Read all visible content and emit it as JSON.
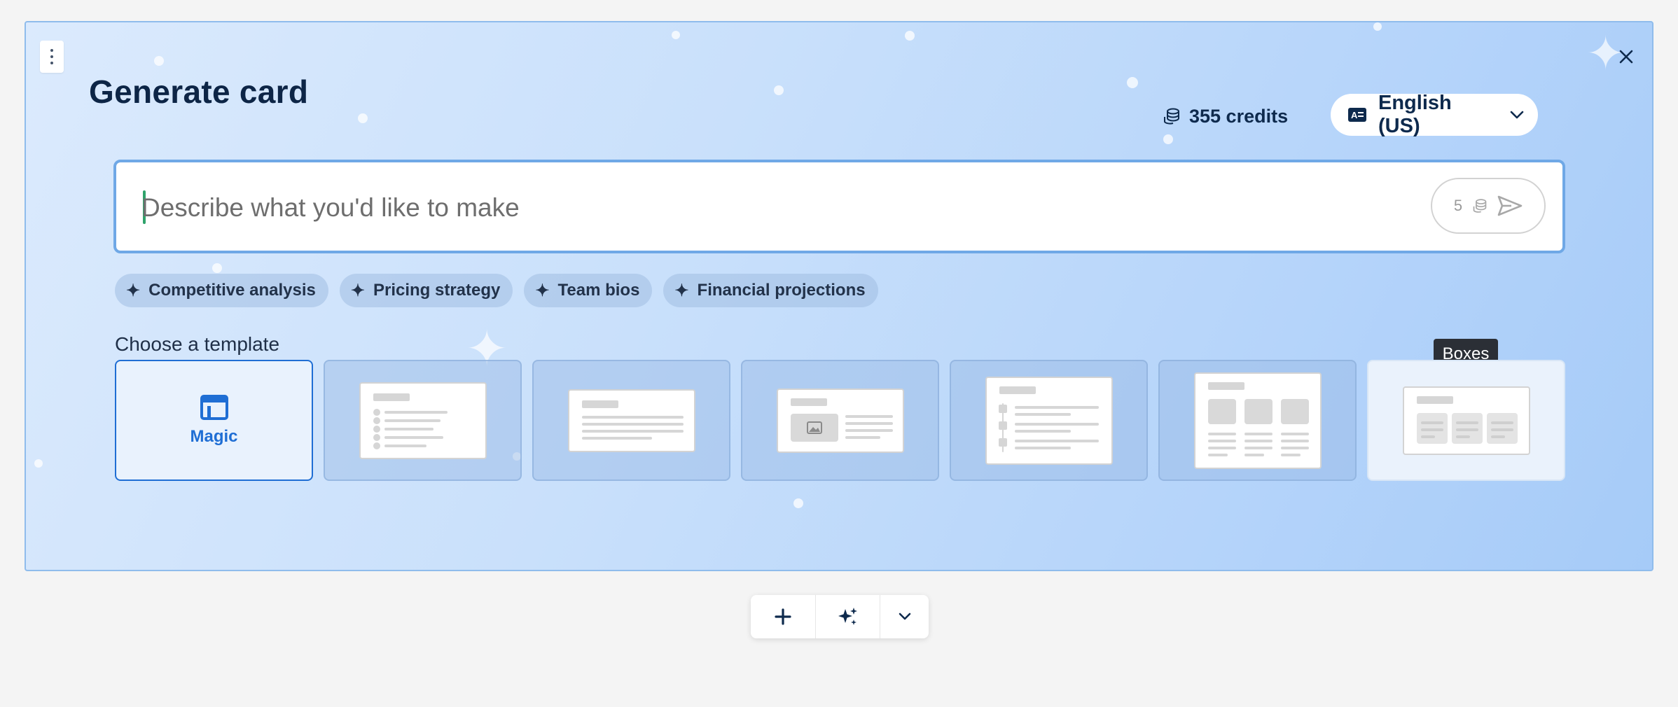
{
  "dialog": {
    "title": "Generate card",
    "credits": "355 credits",
    "language": "English (US)"
  },
  "prompt": {
    "placeholder": "Describe what you'd like to make",
    "cost": "5"
  },
  "suggestions": [
    "Competitive analysis",
    "Pricing strategy",
    "Team bios",
    "Financial projections"
  ],
  "templates": {
    "heading": "Choose a template",
    "magic_label": "Magic",
    "tooltip": "Boxes"
  },
  "colors": {
    "accent": "#1f6ed4",
    "title": "#0d2546",
    "tooltip_bg": "#2b2f36"
  }
}
